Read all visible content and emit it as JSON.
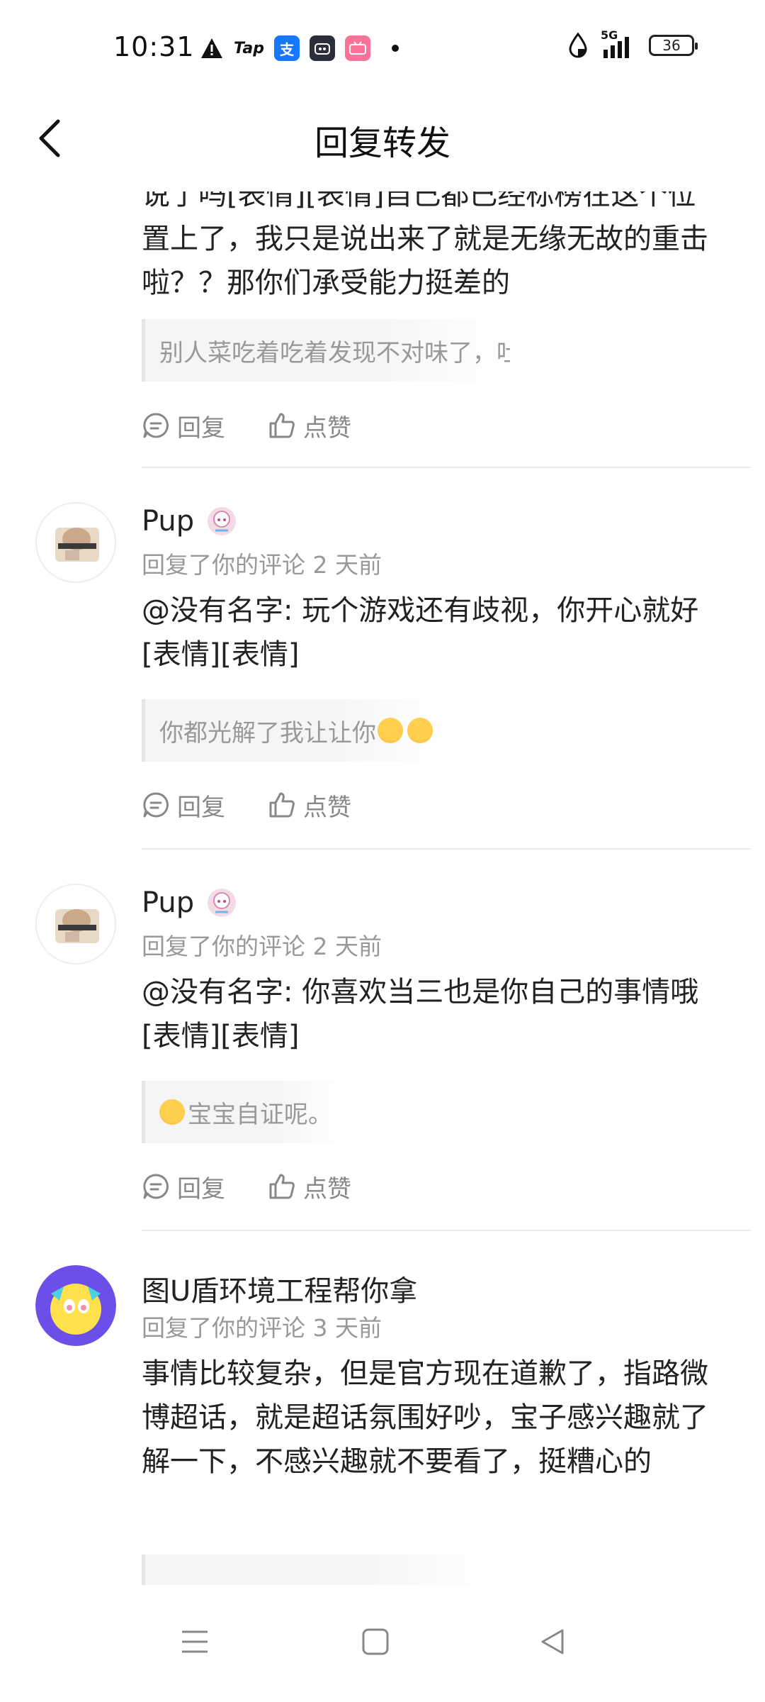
{
  "status_bar": {
    "time": "10:31",
    "tap_label": "Tap",
    "network": "5G",
    "battery": "36"
  },
  "header": {
    "title": "回复转发"
  },
  "first_item": {
    "body": "说了吗[表情][表情]自己都已经标榜在这个位置上了，我只是说出来了就是无缘无故的重击啦？？那你们承受能力挺差的",
    "quote": "别人菜吃着吃着发现不对味了，吐出来也是他..."
  },
  "actions": {
    "reply_label": "回复",
    "like_label": "点赞"
  },
  "items": [
    {
      "name": "Pup",
      "meta": "回复了你的评论 2 天前",
      "body": "@没有名字: 玩个游戏还有歧视，你开心就好[表情][表情]",
      "quote": "你都光解了我让让你"
    },
    {
      "name": "Pup",
      "meta": "回复了你的评论 2 天前",
      "body": "@没有名字: 你喜欢当三也是你自己的事情哦[表情][表情]",
      "quote": "宝宝自证呢。"
    },
    {
      "name": "图U盾环境工程帮你拿",
      "meta": "回复了你的评论 3 天前",
      "body": "事情比较复杂，但是官方现在道歉了，指路微博超话，就是超话氛围好吵，宝子感兴趣就了解一下，不感兴趣就不要看了，挺糟心的"
    }
  ],
  "colors": {
    "alipay": "#1677ff",
    "bilibili": "#fb7299",
    "bot": "#2b2f3a",
    "accent_purple": "#6c4ee8"
  }
}
